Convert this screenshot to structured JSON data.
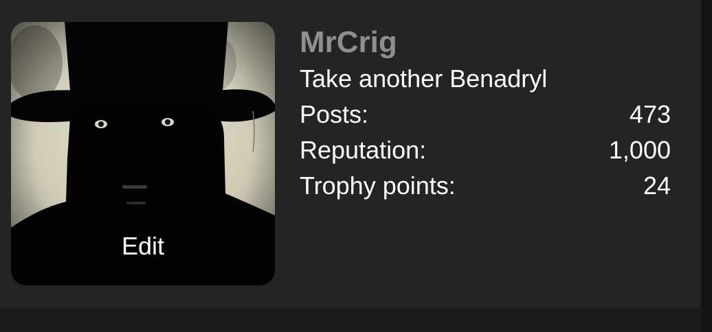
{
  "profile": {
    "username": "MrCrig",
    "custom_title": "Take another Benadryl",
    "avatar_edit_label": "Edit"
  },
  "stats": [
    {
      "label": "Posts:",
      "value": "473"
    },
    {
      "label": "Reputation:",
      "value": "1,000"
    },
    {
      "label": "Trophy points:",
      "value": "24"
    }
  ],
  "colors": {
    "background": "#1b1b1b",
    "card": "#242424",
    "username": "#8f8f8f",
    "text": "#ffffff"
  }
}
